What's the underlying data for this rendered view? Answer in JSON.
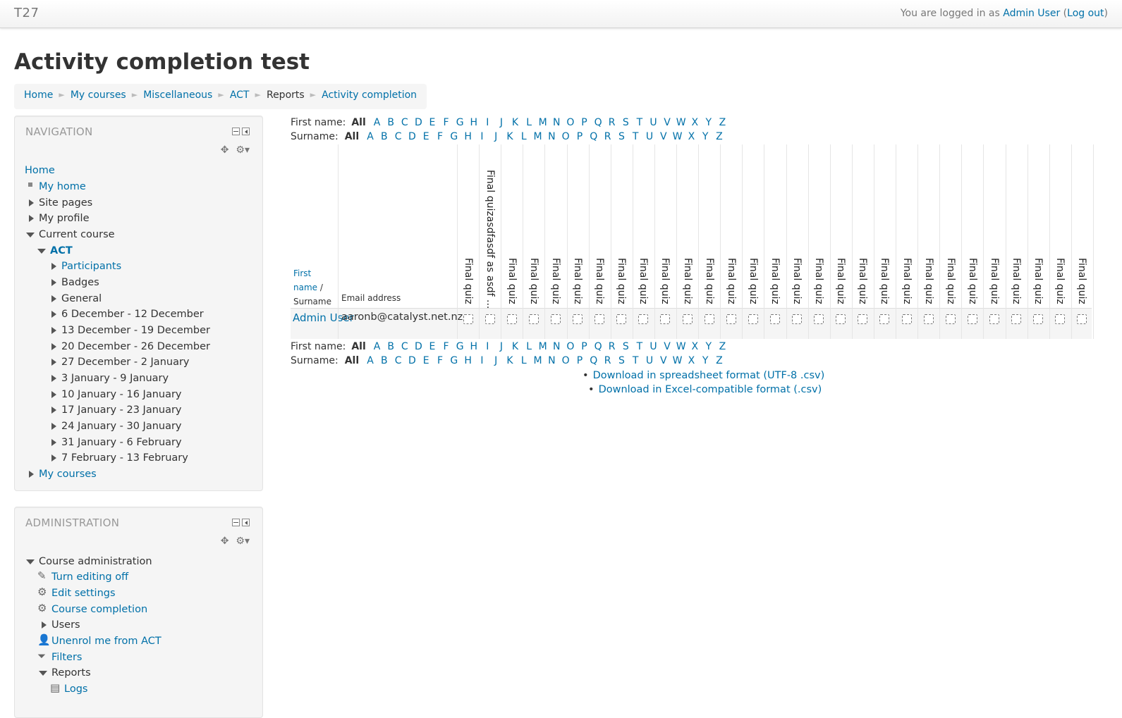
{
  "site": {
    "name": "T27"
  },
  "login": {
    "prefix": "You are logged in as ",
    "user": "Admin User",
    "open": " (",
    "logout": "Log out",
    "close": ")"
  },
  "page": {
    "title": "Activity completion test"
  },
  "breadcrumb": [
    {
      "label": "Home",
      "link": true
    },
    {
      "label": "My courses",
      "link": true
    },
    {
      "label": "Miscellaneous",
      "link": true
    },
    {
      "label": "ACT",
      "link": true
    },
    {
      "label": "Reports",
      "link": false
    },
    {
      "label": "Activity completion",
      "link": true
    }
  ],
  "navigation": {
    "title": "NAVIGATION",
    "items": [
      {
        "label": "Home",
        "marker": "none",
        "link": true
      },
      {
        "label": "My home",
        "marker": "square",
        "link": true
      },
      {
        "label": "Site pages",
        "marker": "right",
        "link": false
      },
      {
        "label": "My profile",
        "marker": "right",
        "link": false
      },
      {
        "label": "Current course",
        "marker": "down",
        "link": false
      },
      {
        "label": "ACT",
        "marker": "down",
        "link": true,
        "bold": true
      },
      {
        "label": "Participants",
        "marker": "right",
        "link": true
      },
      {
        "label": "Badges",
        "marker": "right",
        "link": false
      },
      {
        "label": "General",
        "marker": "right",
        "link": false
      },
      {
        "label": "6 December - 12 December",
        "marker": "right",
        "link": false
      },
      {
        "label": "13 December - 19 December",
        "marker": "right",
        "link": false
      },
      {
        "label": "20 December - 26 December",
        "marker": "right",
        "link": false
      },
      {
        "label": "27 December - 2 January",
        "marker": "right",
        "link": false
      },
      {
        "label": "3 January - 9 January",
        "marker": "right",
        "link": false
      },
      {
        "label": "10 January - 16 January",
        "marker": "right",
        "link": false
      },
      {
        "label": "17 January - 23 January",
        "marker": "right",
        "link": false
      },
      {
        "label": "24 January - 30 January",
        "marker": "right",
        "link": false
      },
      {
        "label": "31 January - 6 February",
        "marker": "right",
        "link": false
      },
      {
        "label": "7 February - 13 February",
        "marker": "right",
        "link": false
      },
      {
        "label": "My courses",
        "marker": "right",
        "link": true
      }
    ]
  },
  "administration": {
    "title": "ADMINISTRATION",
    "items": [
      {
        "label": "Course administration",
        "marker": "down",
        "link": false
      },
      {
        "label": "Turn editing off",
        "marker": "pencil-icon",
        "link": true
      },
      {
        "label": "Edit settings",
        "marker": "gear-icon",
        "link": true
      },
      {
        "label": "Course completion",
        "marker": "gear-icon",
        "link": true
      },
      {
        "label": "Users",
        "marker": "right",
        "link": false
      },
      {
        "label": "Unenrol me from ACT",
        "marker": "user-icon",
        "link": true
      },
      {
        "label": "Filters",
        "marker": "filter-icon",
        "link": true
      },
      {
        "label": "Reports",
        "marker": "down",
        "link": false
      },
      {
        "label": "Logs",
        "marker": "report-icon",
        "link": true
      }
    ]
  },
  "initials": {
    "first_label": "First name:",
    "surname_label": "Surname:",
    "all": "All",
    "letters": [
      "A",
      "B",
      "C",
      "D",
      "E",
      "F",
      "G",
      "H",
      "I",
      "J",
      "K",
      "L",
      "M",
      "N",
      "O",
      "P",
      "Q",
      "R",
      "S",
      "T",
      "U",
      "V",
      "W",
      "X",
      "Y",
      "Z"
    ]
  },
  "report": {
    "first_name_header": "First name",
    "name_separator": " / ",
    "surname_header": "Surname",
    "email_header": "Email address",
    "activities": [
      "Final quiz",
      "Final quizasdfasdf as asdf ...",
      "Final quiz",
      "Final quiz",
      "Final quiz",
      "Final quiz",
      "Final quiz",
      "Final quiz",
      "Final quiz",
      "Final quiz",
      "Final quiz",
      "Final quiz",
      "Final quiz",
      "Final quiz",
      "Final quiz",
      "Final quiz",
      "Final quiz",
      "Final quiz",
      "Final quiz",
      "Final quiz",
      "Final quiz",
      "Final quiz",
      "Final quiz",
      "Final quiz",
      "Final quiz",
      "Final quiz",
      "Final quiz",
      "Final quiz",
      "Final quiz"
    ],
    "rows": [
      {
        "user": "Admin User",
        "email": "aaronb@catalyst.net.nz",
        "completion": "not-completed"
      }
    ]
  },
  "downloads": [
    "Download in spreadsheet format (UTF-8 .csv)",
    "Download in Excel-compatible format (.csv)"
  ]
}
